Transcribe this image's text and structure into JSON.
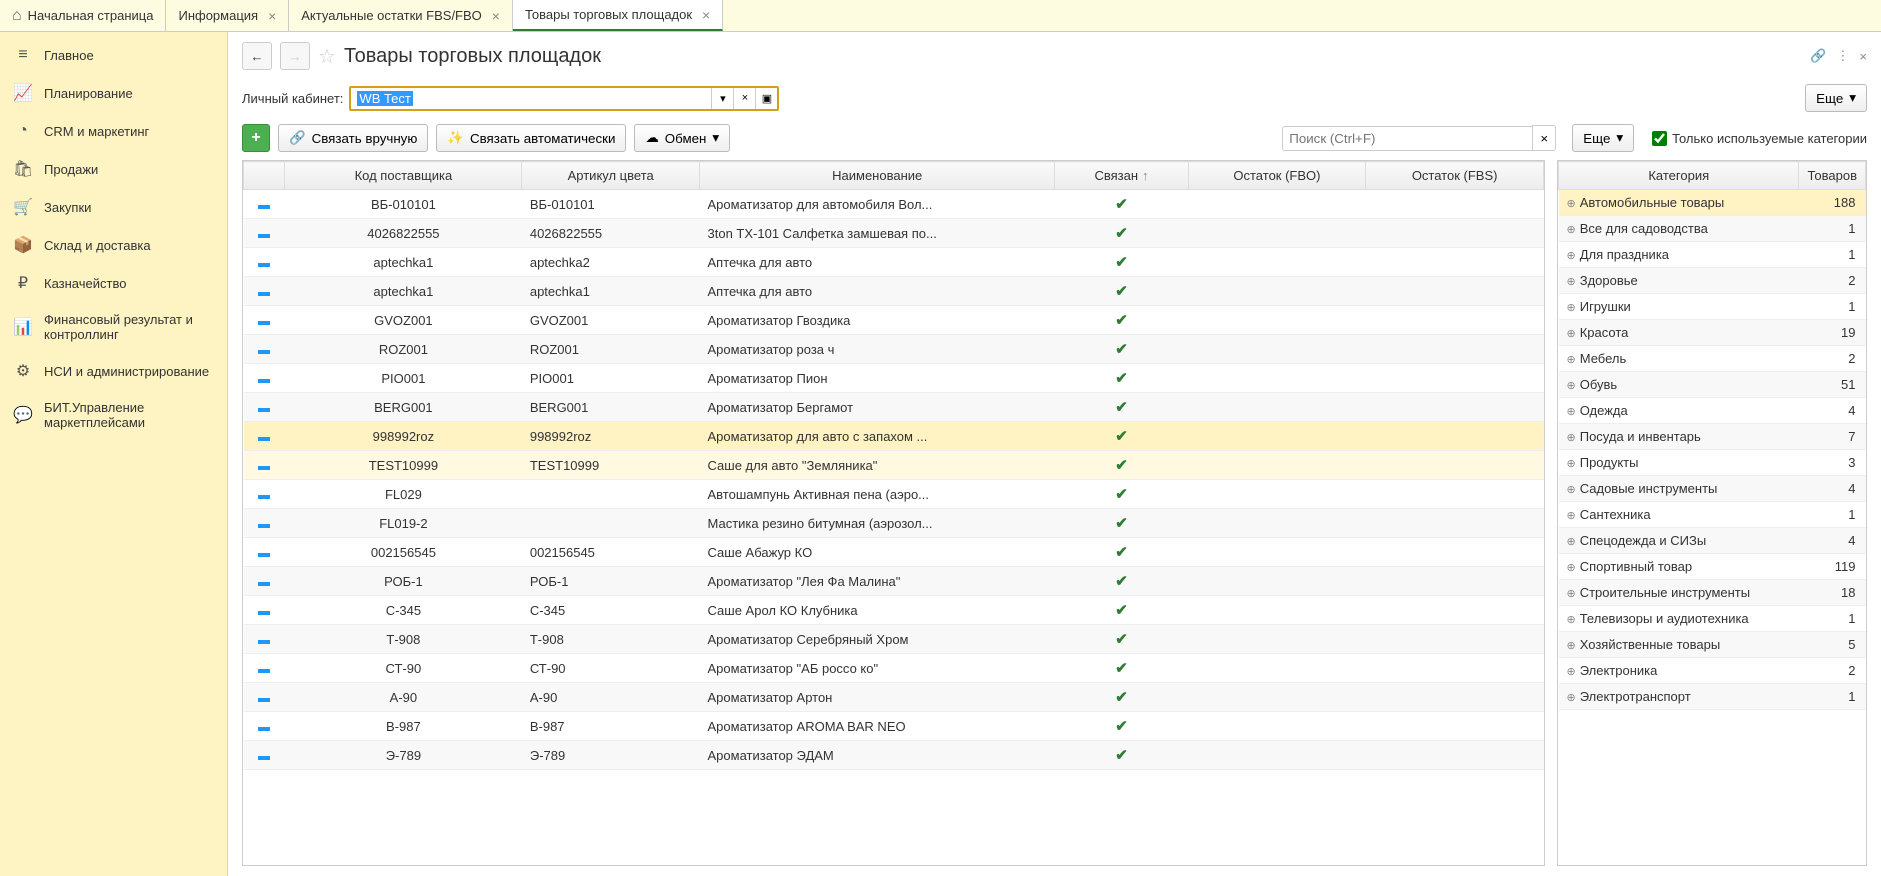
{
  "tabs": [
    {
      "label": "Начальная страница",
      "closable": false,
      "home": true
    },
    {
      "label": "Информация",
      "closable": true
    },
    {
      "label": "Актуальные остатки FBS/FBO",
      "closable": true
    },
    {
      "label": "Товары торговых площадок",
      "closable": true,
      "active": true
    }
  ],
  "sidebar": [
    {
      "icon": "≡",
      "label": "Главное"
    },
    {
      "icon": "📈",
      "label": "Планирование"
    },
    {
      "icon": "◔",
      "label": "CRM и маркетинг"
    },
    {
      "icon": "🛍",
      "label": "Продажи"
    },
    {
      "icon": "🛒",
      "label": "Закупки"
    },
    {
      "icon": "📦",
      "label": "Склад и доставка"
    },
    {
      "icon": "₽",
      "label": "Казначейство"
    },
    {
      "icon": "📊",
      "label": "Финансовый результат и контроллинг"
    },
    {
      "icon": "⚙",
      "label": "НСИ и администрирование"
    },
    {
      "icon": "💬",
      "label": "БИТ.Управление маркетплейсами"
    }
  ],
  "page": {
    "title": "Товары торговых площадок",
    "account_label": "Личный кабинет:",
    "account_value": "WB Тест",
    "more_label": "Еще"
  },
  "toolbar": {
    "link_manual": "Связать вручную",
    "link_auto": "Связать автоматически",
    "exchange": "Обмен",
    "search_placeholder": "Поиск (Ctrl+F)",
    "more": "Еще",
    "only_used": "Только используемые категории"
  },
  "main_table": {
    "headers": {
      "code": "Код поставщика",
      "article": "Артикул цвета",
      "name": "Наименование",
      "linked": "Связан",
      "fbo": "Остаток (FBO)",
      "fbs": "Остаток (FBS)"
    },
    "rows": [
      {
        "code": "ВБ-010101",
        "art": "ВБ-010101",
        "name": "Ароматизатор для автомобиля Вол...",
        "linked": true
      },
      {
        "code": "4026822555",
        "art": "4026822555",
        "name": "3ton ТХ-101 Салфетка замшевая по...",
        "linked": true
      },
      {
        "code": "aptechka1",
        "art": "aptechka2",
        "name": "Аптечка для авто",
        "linked": true
      },
      {
        "code": "aptechka1",
        "art": "aptechka1",
        "name": "Аптечка для авто",
        "linked": true
      },
      {
        "code": "GVOZ001",
        "art": "GVOZ001",
        "name": "Ароматизатор Гвоздика",
        "linked": true
      },
      {
        "code": "ROZ001",
        "art": "ROZ001",
        "name": "Ароматизатор роза ч",
        "linked": true
      },
      {
        "code": "PIO001",
        "art": "PIO001",
        "name": "Ароматизатор Пион",
        "linked": true
      },
      {
        "code": "BERG001",
        "art": "BERG001",
        "name": "Ароматизатор Бергамот",
        "linked": true
      },
      {
        "code": "998992roz",
        "art": "998992roz",
        "name": "Ароматизатор для авто с запахом ...",
        "linked": true,
        "selected": true
      },
      {
        "code": "TEST10999",
        "art": "TEST10999",
        "name": "Саше для авто \"Земляника\"",
        "linked": true,
        "highlight": true
      },
      {
        "code": "FL029",
        "art": "",
        "name": "Автошампунь Активная пена (аэро...",
        "linked": true
      },
      {
        "code": "FL019-2",
        "art": "",
        "name": "Мастика резино битумная (аэрозол...",
        "linked": true
      },
      {
        "code": "002156545",
        "art": "002156545",
        "name": "Саше Абажур КО",
        "linked": true
      },
      {
        "code": "РОБ-1",
        "art": "РОБ-1",
        "name": "Ароматизатор \"Лея Фа Малина\"",
        "linked": true
      },
      {
        "code": "С-345",
        "art": "С-345",
        "name": "Саше Арол КО Клубника",
        "linked": true
      },
      {
        "code": "Т-908",
        "art": "Т-908",
        "name": "Ароматизатор Серебряный Хром",
        "linked": true
      },
      {
        "code": "СТ-90",
        "art": "СТ-90",
        "name": "Ароматизатор \"АБ россо ко\"",
        "linked": true
      },
      {
        "code": "А-90",
        "art": "А-90",
        "name": "Ароматизатор Артон",
        "linked": true
      },
      {
        "code": "В-987",
        "art": "В-987",
        "name": "Ароматизатор AROMA BAR NEO",
        "linked": true
      },
      {
        "code": "Э-789",
        "art": "Э-789",
        "name": "Ароматизатор ЭДАМ",
        "linked": true
      }
    ]
  },
  "side_table": {
    "headers": {
      "category": "Категория",
      "count": "Товаров"
    },
    "rows": [
      {
        "name": "Автомобильные товары",
        "count": 188,
        "selected": true
      },
      {
        "name": "Все для садоводства",
        "count": 1
      },
      {
        "name": "Для праздника",
        "count": 1
      },
      {
        "name": "Здоровье",
        "count": 2
      },
      {
        "name": "Игрушки",
        "count": 1
      },
      {
        "name": "Красота",
        "count": 19
      },
      {
        "name": "Мебель",
        "count": 2
      },
      {
        "name": "Обувь",
        "count": 51
      },
      {
        "name": "Одежда",
        "count": 4
      },
      {
        "name": "Посуда и инвентарь",
        "count": 7
      },
      {
        "name": "Продукты",
        "count": 3
      },
      {
        "name": "Садовые инструменты",
        "count": 4
      },
      {
        "name": "Сантехника",
        "count": 1
      },
      {
        "name": "Спецодежда и СИЗы",
        "count": 4
      },
      {
        "name": "Спортивный товар",
        "count": 119
      },
      {
        "name": "Строительные инструменты",
        "count": 18
      },
      {
        "name": "Телевизоры и аудиотехника",
        "count": 1
      },
      {
        "name": "Хозяйственные товары",
        "count": 5
      },
      {
        "name": "Электроника",
        "count": 2
      },
      {
        "name": "Электротранспорт",
        "count": 1
      }
    ]
  }
}
